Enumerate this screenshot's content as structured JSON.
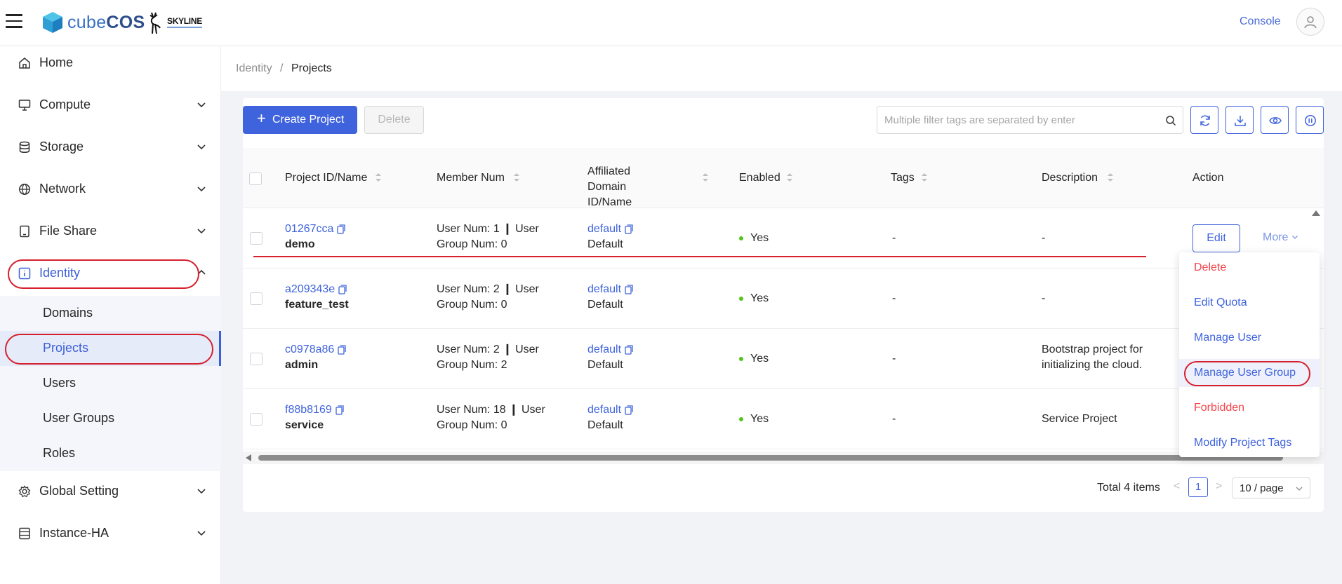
{
  "header": {
    "brand": {
      "prefix": "cube",
      "bold": "COS"
    },
    "partner": "SKYLINE",
    "console_label": "Console"
  },
  "sidebar": {
    "items": [
      {
        "label": "Home",
        "icon": "home-icon"
      },
      {
        "label": "Compute",
        "icon": "monitor-icon"
      },
      {
        "label": "Storage",
        "icon": "database-icon"
      },
      {
        "label": "Network",
        "icon": "globe-icon"
      },
      {
        "label": "File Share",
        "icon": "tablet-icon"
      },
      {
        "label": "Identity",
        "icon": "info-icon"
      },
      {
        "label": "Global Setting",
        "icon": "gear-icon"
      },
      {
        "label": "Instance-HA",
        "icon": "server-icon"
      }
    ],
    "identity_sub": [
      "Domains",
      "Projects",
      "Users",
      "User Groups",
      "Roles"
    ]
  },
  "breadcrumb": {
    "parent": "Identity",
    "separator": "/",
    "current": "Projects"
  },
  "toolbar": {
    "create_label": "Create Project",
    "delete_label": "Delete",
    "search_placeholder": "Multiple filter tags are separated by enter"
  },
  "table": {
    "columns": {
      "id_name": "Project ID/Name",
      "member": "Member Num",
      "domain": "Affiliated Domain ID/Name",
      "enabled": "Enabled",
      "tags": "Tags",
      "description": "Description",
      "action": "Action"
    },
    "rows": [
      {
        "id": "01267cca",
        "name": "demo",
        "member1": "User Num: 1 ❙ User",
        "member2": "Group Num: 0",
        "domain_id": "default",
        "domain_name": "Default",
        "enabled": "Yes",
        "tags": "-",
        "desc1": "-",
        "desc2": ""
      },
      {
        "id": "a209343e",
        "name": "feature_test",
        "member1": "User Num: 2 ❙ User",
        "member2": "Group Num: 0",
        "domain_id": "default",
        "domain_name": "Default",
        "enabled": "Yes",
        "tags": "-",
        "desc1": "-",
        "desc2": ""
      },
      {
        "id": "c0978a86",
        "name": "admin",
        "member1": "User Num: 2 ❙ User",
        "member2": "Group Num: 2",
        "domain_id": "default",
        "domain_name": "Default",
        "enabled": "Yes",
        "tags": "-",
        "desc1": "Bootstrap project for",
        "desc2": "initializing the cloud."
      },
      {
        "id": "f88b8169",
        "name": "service",
        "member1": "User Num: 18 ❙ User",
        "member2": "Group Num: 0",
        "domain_id": "default",
        "domain_name": "Default",
        "enabled": "Yes",
        "tags": "-",
        "desc1": "Service Project",
        "desc2": ""
      }
    ],
    "edit_label": "Edit",
    "more_label": "More"
  },
  "dropdown": [
    {
      "label": "Delete",
      "tone": "red"
    },
    {
      "label": "Edit Quota",
      "tone": "blue"
    },
    {
      "label": "Manage User",
      "tone": "blue"
    },
    {
      "label": "Manage User Group",
      "tone": "blue"
    },
    {
      "label": "Forbidden",
      "tone": "red"
    },
    {
      "label": "Modify Project Tags",
      "tone": "blue"
    }
  ],
  "pagination": {
    "total": "Total 4 items",
    "page": "1",
    "size": "10 / page",
    "prev": "<",
    "next": ">"
  },
  "colors": {
    "accent": "#3f63dd",
    "danger": "#f5454b",
    "success": "#52c41a",
    "annotation": "#d6202c"
  }
}
